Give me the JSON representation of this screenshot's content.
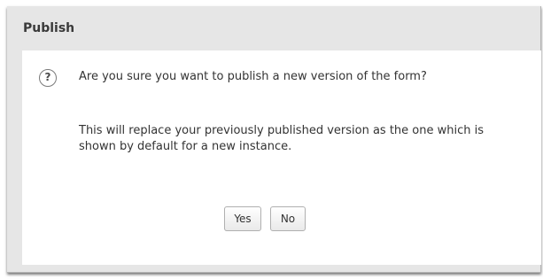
{
  "dialog": {
    "title": "Publish",
    "icon": "help-circle-icon",
    "question": "Are you sure you want to publish a new version of the form?",
    "detail": "This will replace your previously published version as the one which is shown by default for a new instance.",
    "buttons": {
      "yes_label": "Yes",
      "no_label": "No"
    }
  }
}
